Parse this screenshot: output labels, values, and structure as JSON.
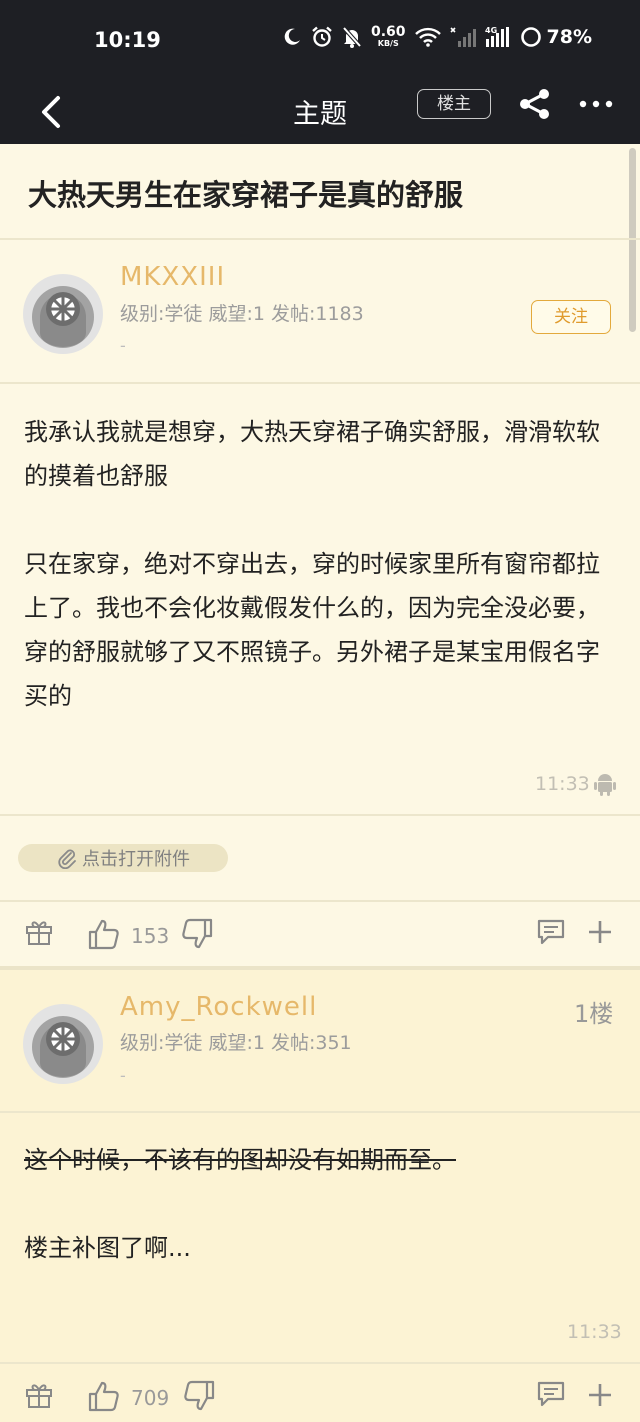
{
  "status_bar": {
    "time": "10:19",
    "net_speed_value": "0.60",
    "net_speed_unit": "KB/S",
    "battery": "78%",
    "network_type": "4G"
  },
  "nav": {
    "title": "主题",
    "op_tag": "楼主"
  },
  "thread": {
    "title": "大热天男生在家穿裙子是真的舒服"
  },
  "post1": {
    "username": "MKXXIII",
    "meta": "级别:学徒 威望:1 发帖:1183",
    "dash": "-",
    "follow_label": "关注",
    "paragraph1": "我承认我就是想穿，大热天穿裙子确实舒服，滑滑软软的摸着也舒服",
    "paragraph2": "只在家穿，绝对不穿出去，穿的时候家里所有窗帘都拉上了。我也不会化妆戴假发什么的，因为完全没必要，穿的舒服就够了又不照镜子。另外裙子是某宝用假名字买的",
    "time": "11:33",
    "attachment_label": "点击打开附件",
    "like_count": "153"
  },
  "post2": {
    "username": "Amy_Rockwell",
    "floor": "1楼",
    "meta": "级别:学徒 威望:1 发帖:351",
    "dash": "-",
    "strike_line": "这个时候，不该有的图却没有如期而至。",
    "line2": "楼主补图了啊...",
    "time": "11:33",
    "like_count": "709"
  },
  "colors": {
    "background": "#fdf8e4",
    "header": "#1e1f24",
    "username": "#e6b86a",
    "follow": "#e09b2d"
  }
}
